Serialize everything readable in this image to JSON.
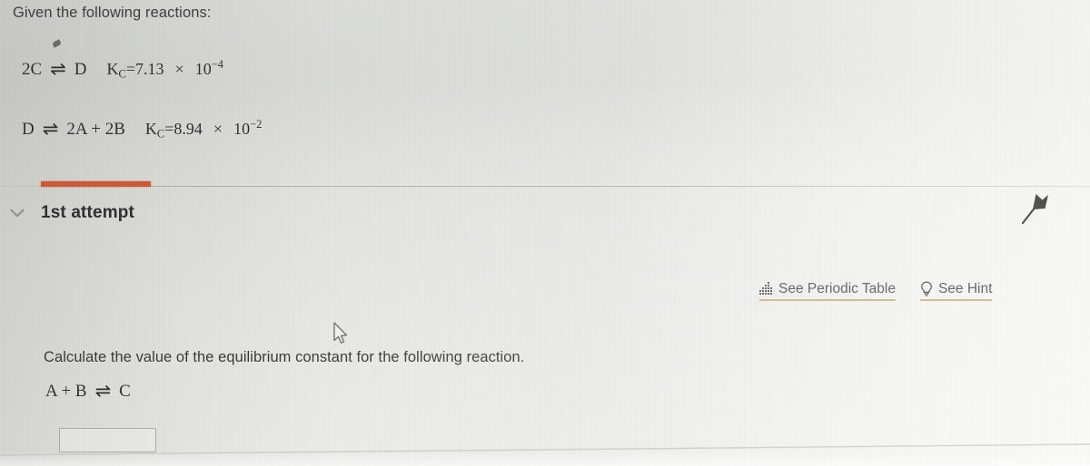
{
  "prompt": {
    "heading": "Given the following reactions:"
  },
  "reactions": [
    {
      "left": "2C",
      "arrow": "⇌",
      "right": "D",
      "constant_symbol": "K",
      "constant_subscript": "C",
      "equals": "=",
      "coefficient": "7.13",
      "times": "×",
      "base": "10",
      "exponent": "−4"
    },
    {
      "left": "D",
      "arrow": "⇌",
      "right": "2A + 2B",
      "constant_symbol": "K",
      "constant_subscript": "C",
      "equals": "=",
      "coefficient": "8.94",
      "times": "×",
      "base": "10",
      "exponent": "−2"
    }
  ],
  "attempt": {
    "title": "1st attempt",
    "collapse_icon": "chevron-down-icon",
    "flag_icon": "flag-icon",
    "indicator_color": "#cf4e26"
  },
  "helpers": [
    {
      "label": "See Periodic Table",
      "icon": "periodic-table-grid-icon",
      "underline_color": "#baa060"
    },
    {
      "label": "See Hint",
      "icon": "lightbulb-icon",
      "underline_color": "#baa060"
    }
  ],
  "question": {
    "text": "Calculate the value of the equilibrium constant for the following reaction.",
    "reaction_left": "A + B",
    "reaction_arrow": "⇌",
    "reaction_right": "C",
    "answer_value": "",
    "answer_placeholder": ""
  },
  "cursor": {
    "icon": "mouse-pointer-icon"
  }
}
